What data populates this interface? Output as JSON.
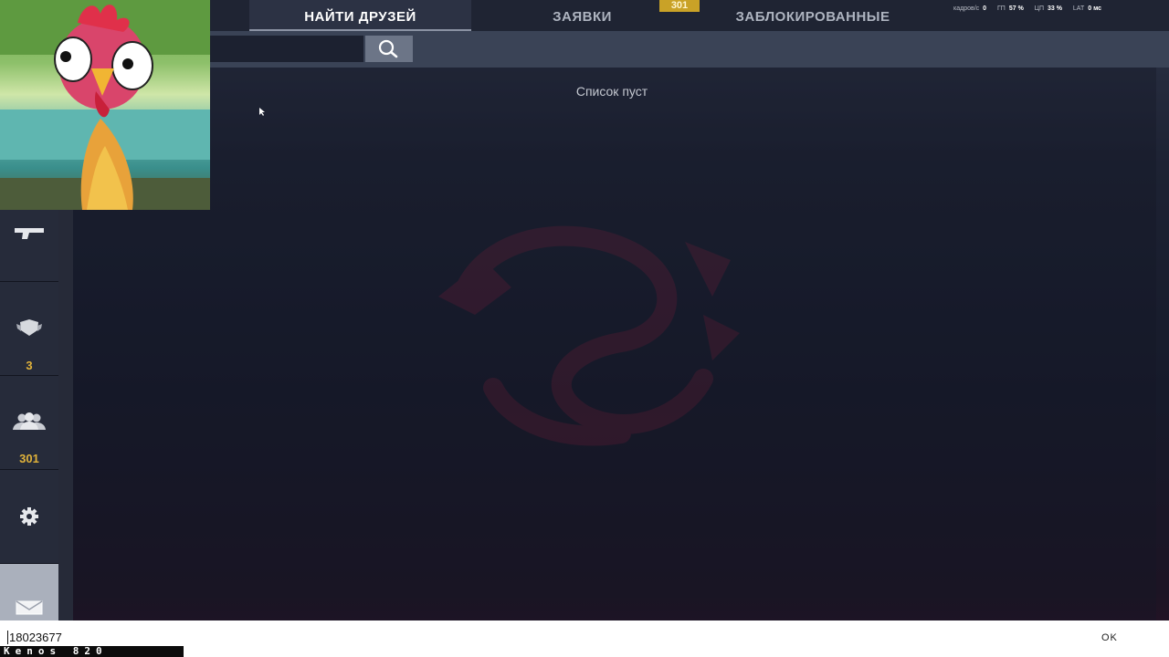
{
  "tabs": {
    "find_friends": "НАЙТИ ДРУЗЕЙ",
    "requests": "ЗАЯВКИ",
    "blocked": "ЗАБЛОКИРОВАННЫЕ",
    "requests_badge": "301"
  },
  "perf": {
    "fps_label": "кадров/с",
    "fps_value": "0",
    "gpu_label": "ГП",
    "gpu_value": "57 %",
    "cpu_label": "ЦП",
    "cpu_value": "33 %",
    "lat_label": "LAT",
    "lat_value": "0 мс"
  },
  "search": {
    "value": ""
  },
  "content": {
    "empty_message": "Список пуст"
  },
  "sidebar": {
    "clan_count": "3",
    "friends_count": "301"
  },
  "console": {
    "input_value": "18023677",
    "ok_label": "OK"
  },
  "overlay": {
    "streamer_name": "Kenos 820"
  },
  "colors": {
    "accent_gold": "#c9a227",
    "count_gold": "#e0b23a",
    "background": "#161a2a"
  }
}
